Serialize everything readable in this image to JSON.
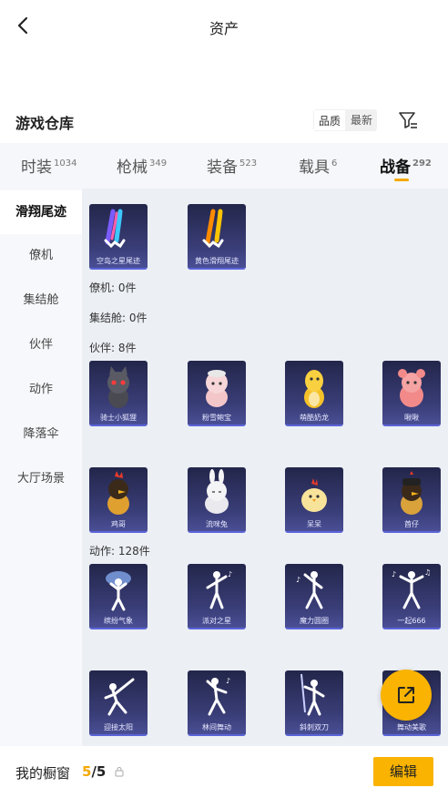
{
  "header": {
    "title": "资产"
  },
  "warehouse": {
    "title": "游戏仓库",
    "sort_options": [
      "品质",
      "最新"
    ],
    "active_sort": "品质"
  },
  "tabs": [
    {
      "label": "时装",
      "count": "1034"
    },
    {
      "label": "枪械",
      "count": "349"
    },
    {
      "label": "装备",
      "count": "523"
    },
    {
      "label": "载具",
      "count": "6"
    },
    {
      "label": "战备",
      "count": "292"
    }
  ],
  "active_tab": "战备",
  "sidebar": {
    "items": [
      {
        "label": "滑翔尾迹"
      },
      {
        "label": "僚机"
      },
      {
        "label": "集结舱"
      },
      {
        "label": "伙伴"
      },
      {
        "label": "动作"
      },
      {
        "label": "降落伞"
      },
      {
        "label": "大厅场景"
      }
    ],
    "active": "滑翔尾迹"
  },
  "groups": {
    "wingman": "僚机: 0件",
    "pod": "集结舱: 0件",
    "partner": "伙伴: 8件",
    "emote": "动作: 128件"
  },
  "items": {
    "trails": [
      {
        "name": "空岛之星尾迹",
        "icon": "trail-rainbow-icon"
      },
      {
        "name": "黄色滑翔尾迹",
        "icon": "trail-yellow-icon"
      }
    ],
    "partners": [
      {
        "name": "骑士小狐狸"
      },
      {
        "name": "粉雪鲍宝"
      },
      {
        "name": "萌酷奶龙"
      },
      {
        "name": "啾啾"
      },
      {
        "name": "鸡哥"
      },
      {
        "name": "流咪兔"
      },
      {
        "name": "呆呆"
      },
      {
        "name": "酋仔"
      }
    ],
    "emotes": [
      {
        "name": "缤纷气象"
      },
      {
        "name": "派对之星"
      },
      {
        "name": "魔力圆圈"
      },
      {
        "name": "一起666"
      },
      {
        "name": "迎接太阳"
      },
      {
        "name": "林间舞动"
      },
      {
        "name": "斜刺双刀"
      },
      {
        "name": "舞动美歌"
      }
    ]
  },
  "bottom": {
    "label": "我的橱窗",
    "current": "5",
    "separator": "/",
    "total": "5",
    "edit_label": "编辑"
  },
  "colors": {
    "accent": "#f9b300",
    "card_bg": "#2a2d55"
  }
}
